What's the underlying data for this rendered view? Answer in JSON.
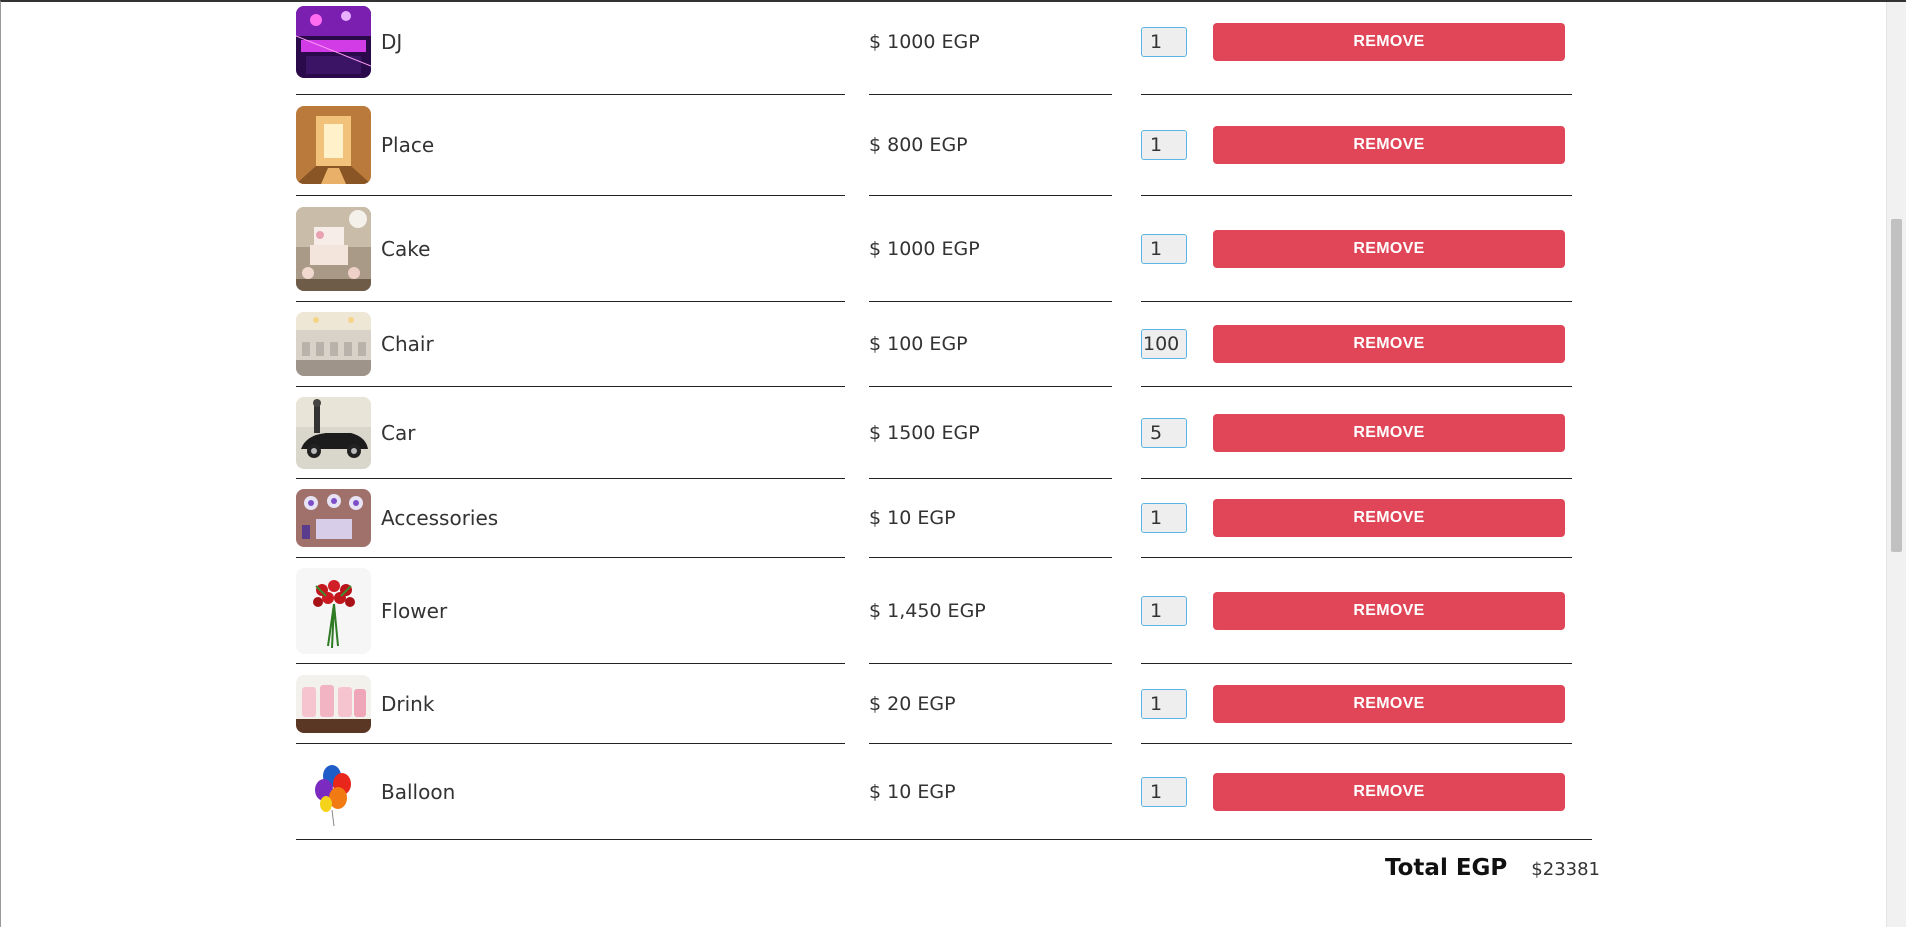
{
  "cart": {
    "items": [
      {
        "name": "DJ",
        "price": "$ 1000 EGP",
        "qty": "1",
        "remove": "REMOVE",
        "image": "dj-stage-image"
      },
      {
        "name": "Place",
        "price": "$ 800 EGP",
        "qty": "1",
        "remove": "REMOVE",
        "image": "hall-image"
      },
      {
        "name": "Cake",
        "price": "$ 1000 EGP",
        "qty": "1",
        "remove": "REMOVE",
        "image": "cake-image"
      },
      {
        "name": "Chair",
        "price": "$ 100 EGP",
        "qty": "100",
        "remove": "REMOVE",
        "image": "chairs-image"
      },
      {
        "name": "Car",
        "price": "$ 1500 EGP",
        "qty": "5",
        "remove": "REMOVE",
        "image": "car-image"
      },
      {
        "name": "Accessories",
        "price": "$ 10 EGP",
        "qty": "1",
        "remove": "REMOVE",
        "image": "accessories-image"
      },
      {
        "name": "Flower",
        "price": "$ 1,450 EGP",
        "qty": "1",
        "remove": "REMOVE",
        "image": "roses-image"
      },
      {
        "name": "Drink",
        "price": "$ 20 EGP",
        "qty": "1",
        "remove": "REMOVE",
        "image": "drinks-image"
      },
      {
        "name": "Balloon",
        "price": "$ 10 EGP",
        "qty": "1",
        "remove": "REMOVE",
        "image": "balloons-image"
      }
    ],
    "total_label": "Total EGP",
    "total_value": "$23381"
  },
  "colors": {
    "remove_button": "#e04657",
    "qty_border": "#5bb4e5",
    "row_divider": "#222222"
  }
}
